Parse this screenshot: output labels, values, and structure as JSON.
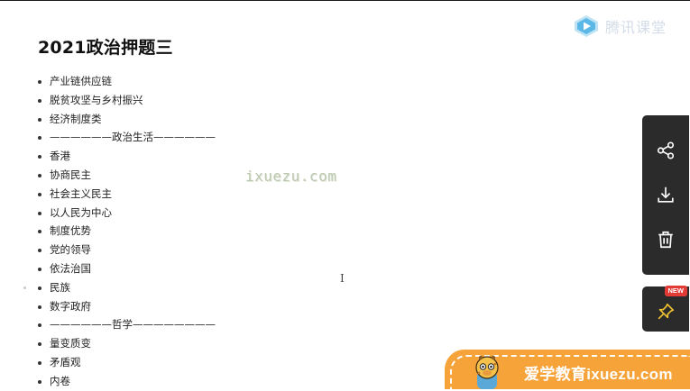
{
  "page": {
    "title": "2021政治押题三"
  },
  "outline": {
    "items": [
      {
        "label": "产业链供应链"
      },
      {
        "label": "脱贫攻坚与乡村振兴"
      },
      {
        "label": "经济制度类"
      },
      {
        "label": "——————政治生活——————"
      },
      {
        "label": "香港"
      },
      {
        "label": "协商民主"
      },
      {
        "label": "社会主义民主"
      },
      {
        "label": "以人民为中心"
      },
      {
        "label": "制度优势"
      },
      {
        "label": "党的领导"
      },
      {
        "label": "依法治国"
      },
      {
        "label": "民族"
      },
      {
        "label": "数字政府"
      },
      {
        "label": "——————哲学————————"
      },
      {
        "label": "量变质变"
      },
      {
        "label": "矛盾观"
      },
      {
        "label": "内卷"
      }
    ]
  },
  "watermark": {
    "center_text": "ixuezu.com",
    "brand_text": "腾讯课堂"
  },
  "side_toolbar": {
    "buttons": [
      {
        "icon": "share-icon"
      },
      {
        "icon": "download-icon"
      },
      {
        "icon": "trash-icon"
      }
    ],
    "pin": {
      "icon": "pin-icon",
      "badge": "NEW"
    }
  },
  "promo": {
    "text": "爱学教育ixuezu.com"
  },
  "colors": {
    "toolbar_bg": "#2b2b2b",
    "promo_bg": "#f6a33a",
    "badge_bg": "#e23b36",
    "brand_icon": "#5bb7e6"
  }
}
